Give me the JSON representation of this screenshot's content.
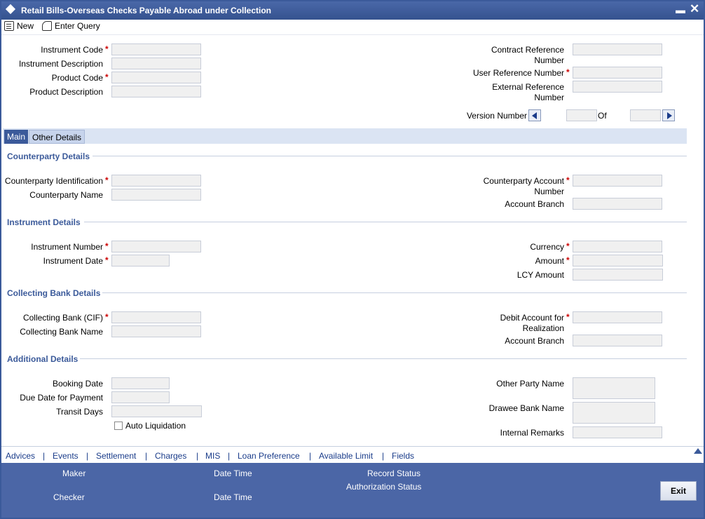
{
  "window": {
    "title": "Retail Bills-Overseas Checks Payable Abroad under Collection",
    "minimize": "▬",
    "close": "✕"
  },
  "toolbar": {
    "new_label": "New",
    "enter_query_label": "Enter Query"
  },
  "header": {
    "instrument_code": "Instrument Code",
    "instrument_description": "Instrument Description",
    "product_code": "Product Code",
    "product_description": "Product Description",
    "contract_reference_1": "Contract Reference",
    "contract_reference_2": "Number",
    "user_reference_number": "User Reference Number",
    "external_reference_1": "External Reference",
    "external_reference_2": "Number",
    "version_number": "Version Number",
    "of": "Of",
    "required_mark": "*"
  },
  "tabs": [
    {
      "label": "Main"
    },
    {
      "label": "Other Details"
    }
  ],
  "counterparty": {
    "title": "Counterparty Details",
    "identification": "Counterparty Identification",
    "name": "Counterparty Name",
    "account_number_1": "Counterparty Account",
    "account_number_2": "Number",
    "account_branch": "Account Branch"
  },
  "instrument": {
    "title": "Instrument Details",
    "number": "Instrument Number",
    "date": "Instrument Date",
    "currency": "Currency",
    "amount": "Amount",
    "lcy_amount": "LCY Amount"
  },
  "collecting_bank": {
    "title": "Collecting Bank Details",
    "cif": "Collecting Bank (CIF)",
    "name": "Collecting Bank Name",
    "debit_account_1": "Debit Account for",
    "debit_account_2": "Realization",
    "account_branch": "Account Branch"
  },
  "additional": {
    "title": "Additional Details",
    "booking_date": "Booking Date",
    "due_date": "Due Date for Payment",
    "transit_days": "Transit Days",
    "auto_liquidation": "Auto Liquidation",
    "other_party_name": "Other Party Name",
    "drawee_bank_name": "Drawee Bank Name",
    "internal_remarks": "Internal Remarks"
  },
  "links": [
    "Advices",
    "Events",
    "Settlement",
    "Charges",
    "MIS",
    "Loan Preference",
    "Available Limit",
    "Fields"
  ],
  "link_separator": "|",
  "footer": {
    "maker": "Maker",
    "checker": "Checker",
    "date_time": "Date Time",
    "record_status": "Record Status",
    "authorization_status": "Authorization Status",
    "exit_label": "Exit"
  },
  "colors": {
    "title_bar": "#3b5a9a",
    "footer": "#4b66a6",
    "section_title": "#3b5a9a",
    "required": "#cc0000"
  }
}
